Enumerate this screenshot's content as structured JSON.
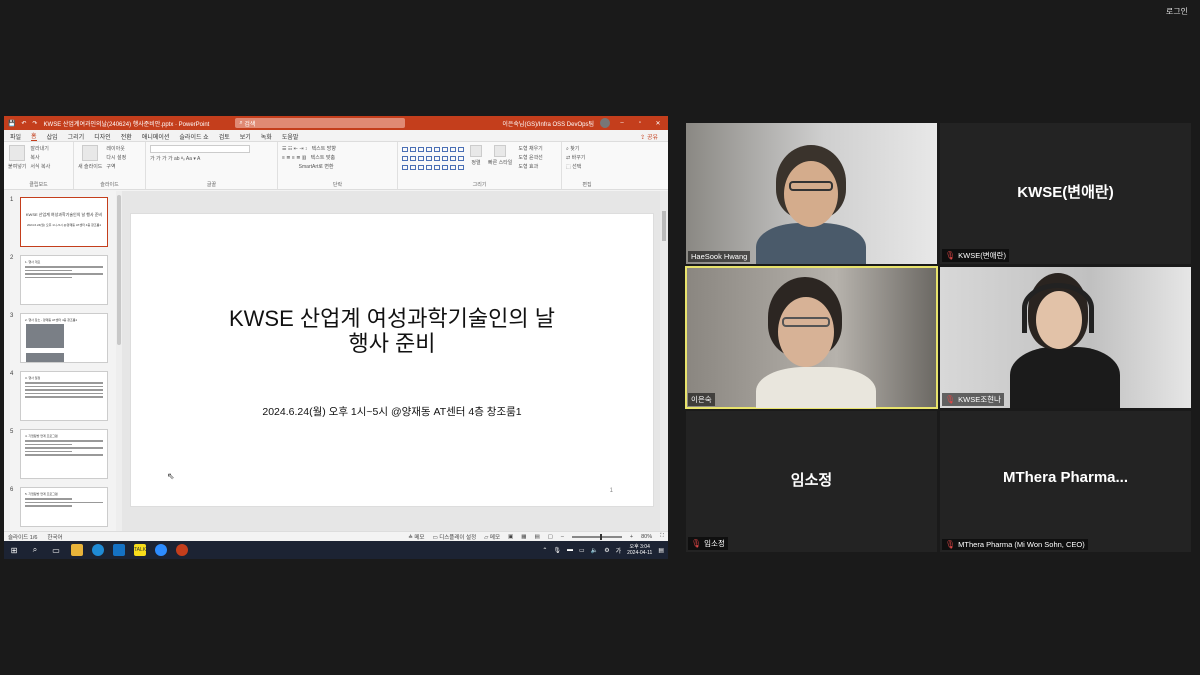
{
  "topbar": {
    "login_label": "로그인"
  },
  "ppt": {
    "titlebar": {
      "filename": "KWSE 산업계여과인의날(240624) 행사준비안.pptx  ·  PowerPoint",
      "search_placeholder": "검색",
      "account": "이은숙님(GS)/Infra OSS DevOps팀"
    },
    "menu": [
      "파일",
      "홈",
      "삽입",
      "그리기",
      "디자인",
      "전환",
      "애니메이션",
      "슬라이드 쇼",
      "검토",
      "보기",
      "녹화",
      "도움말"
    ],
    "active_menu_index": 1,
    "share_label": "공유",
    "ribbon": {
      "clipboard": {
        "paste": "붙여넣기",
        "cut": "잘라내기",
        "copy": "복사",
        "format": "서식 복사",
        "label": "클립보드"
      },
      "slides": {
        "new": "새 슬라이드",
        "layout": "레이아웃",
        "reset": "다시 설정",
        "section": "구역",
        "label": "슬라이드"
      },
      "font": {
        "label": "글꼴"
      },
      "paragraph": {
        "dir": "텍스트 방향",
        "align": "텍스트 맞춤",
        "smartart": "SmartArt로 변환",
        "label": "단락"
      },
      "drawing": {
        "arrange": "정렬",
        "styles": "빠른 스타일",
        "fill": "도형 채우기",
        "outline": "도형 윤곽선",
        "effects": "도형 효과",
        "label": "그리기"
      },
      "editing": {
        "find": "찾기",
        "replace": "바꾸기",
        "select": "선택",
        "label": "편집"
      }
    },
    "thumbnails": [
      {
        "num": "1",
        "title": "KWSE 산업계 여성과학기술인의 날 행사 준비",
        "sub": "2024.6.24(월) 오후 1시~5시 @양재동 AT센터 4층 창조룸1"
      },
      {
        "num": "2",
        "title": "1. 행사 개요"
      },
      {
        "num": "3",
        "title": "2. 행사 장소 - 양재동 AT센터 4층 창조룸1"
      },
      {
        "num": "4",
        "title": "3. 행사 일정"
      },
      {
        "num": "5",
        "title": "4. 기업탐방 연계 프로그램"
      },
      {
        "num": "6",
        "title": "5. 기업탐방 연계 프로그램"
      }
    ],
    "slide": {
      "title_line1": "KWSE 산업계 여성과학기술인의 날",
      "title_line2": "행사 준비",
      "subtitle": "2024.6.24(월) 오후 1시~5시 @양재동 AT센터 4층 창조룸1",
      "page_number": "1"
    },
    "status": {
      "slide_count": "슬라이드 1/6",
      "language": "한국어",
      "notes": "메모",
      "display": "디스플레이 설정",
      "comments": "메모",
      "zoom": "80%"
    }
  },
  "taskbar": {
    "time": "오후 3:04",
    "date": "2024-04-11",
    "ime": "가"
  },
  "participants": [
    {
      "name": "HaeSook Hwang",
      "video": true,
      "muted": false
    },
    {
      "name": "KWSE(변애란)",
      "video": false,
      "muted": true,
      "display_name": "KWSE(변애란)"
    },
    {
      "name": "이은숙",
      "video": true,
      "muted": false,
      "speaking": true
    },
    {
      "name": "KWSE조현나",
      "video": true,
      "muted": true
    },
    {
      "name": "임소정",
      "video": false,
      "muted": true,
      "display_name": "임소정"
    },
    {
      "name": "MThera Pharma (Mi Won Sohn, CEO)",
      "video": false,
      "muted": true,
      "display_name": "MThera  Pharma..."
    }
  ]
}
